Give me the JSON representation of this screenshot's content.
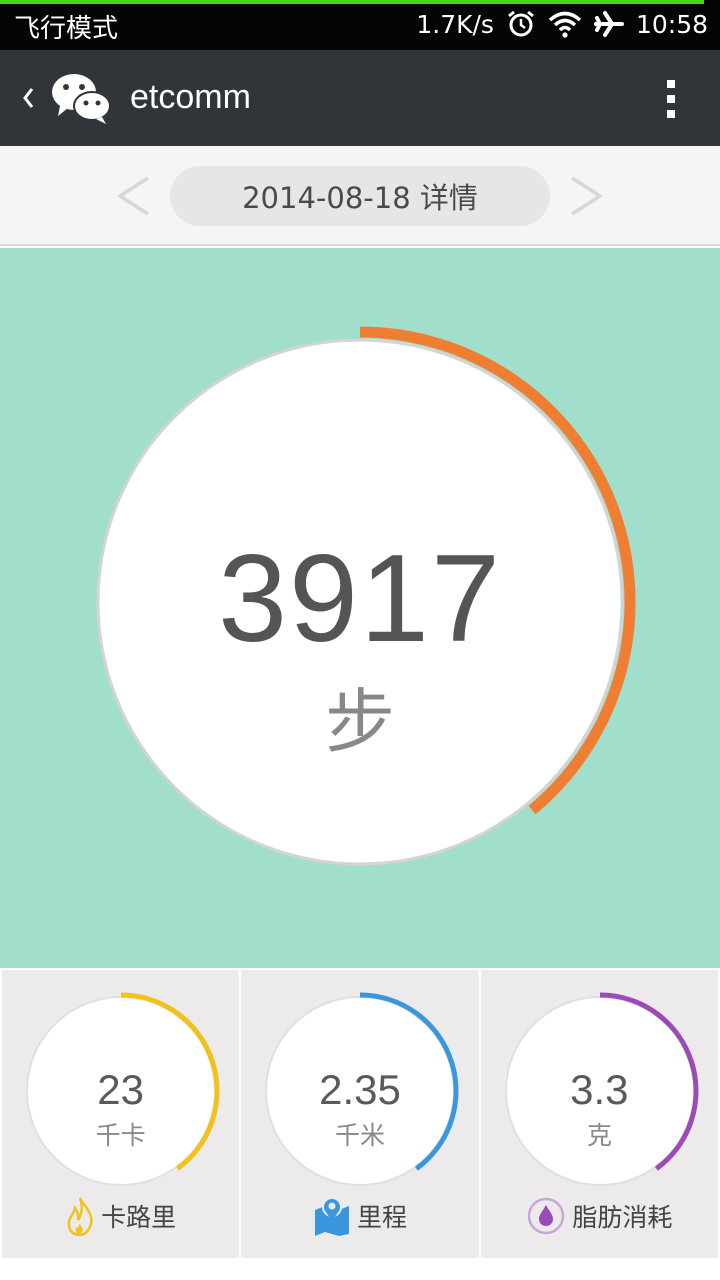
{
  "status_bar": {
    "mode_text": "飞行模式",
    "speed": "1.7K/s",
    "time": "10:58",
    "icons": [
      "alarm-icon",
      "wifi-icon",
      "airplane-icon"
    ]
  },
  "title_bar": {
    "title": "etcomm",
    "icons": [
      "back-chevron-icon",
      "wechat-logo-icon",
      "more-vertical-icon"
    ]
  },
  "date_bar": {
    "date_label": "2014-08-18 详情",
    "prev_arrow": "<",
    "next_arrow": ">"
  },
  "main": {
    "steps": "3917",
    "steps_unit": "步",
    "progress_fraction": 0.39,
    "accent_color": "#f07e32",
    "background_color": "#a1dfcc"
  },
  "stats": [
    {
      "value": "23",
      "unit": "千卡",
      "label": "卡路里",
      "icon": "flame-icon",
      "color": "#f2c21b",
      "fraction": 0.4
    },
    {
      "value": "2.35",
      "unit": "千米",
      "label": "里程",
      "icon": "map-pin-icon",
      "color": "#3a97de",
      "fraction": 0.4
    },
    {
      "value": "3.3",
      "unit": "克",
      "label": "脂肪消耗",
      "icon": "drop-icon",
      "color": "#9b4ab8",
      "fraction": 0.4
    }
  ]
}
